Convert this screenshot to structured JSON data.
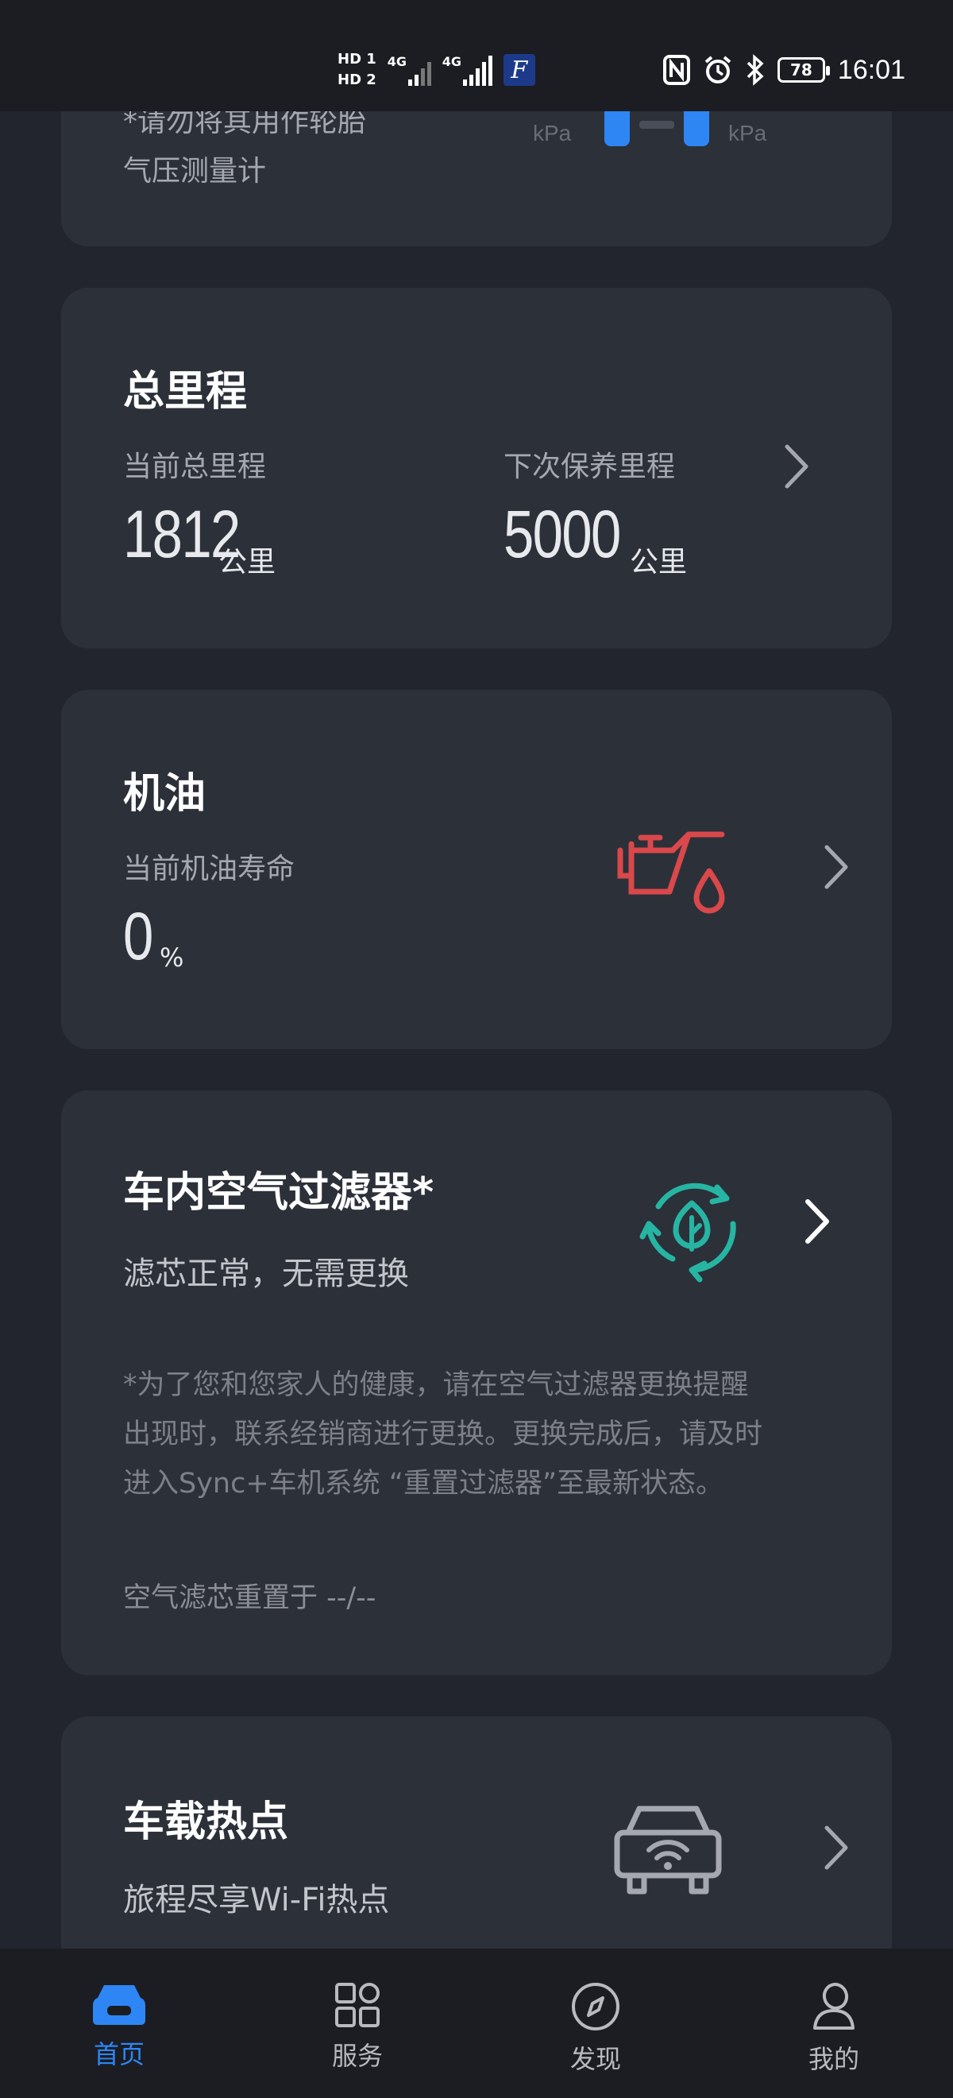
{
  "status_bar": {
    "hd1": "HD 1",
    "hd2": "HD 2",
    "net1": "4G",
    "net2": "4G",
    "app_badge": "F",
    "battery": "78",
    "time": "16:01"
  },
  "tire_card": {
    "note_line1": "*请勿将其用作轮胎",
    "note_line2": "气压测量计",
    "unit_left": "kPa",
    "unit_right": "kPa"
  },
  "mileage_card": {
    "title": "总里程",
    "current_label": "当前总里程",
    "current_value": "1812",
    "current_unit": "公里",
    "next_label": "下次保养里程",
    "next_value": "5000",
    "next_unit": "公里"
  },
  "oil_card": {
    "title": "机油",
    "life_label": "当前机油寿命",
    "life_value": "0",
    "life_unit": "%",
    "icon_color": "#d9484a"
  },
  "filter_card": {
    "title": "车内空气过滤器*",
    "status": "滤芯正常，无需更换",
    "note_line1": "*为了您和您家人的健康，请在空气过滤器更换提醒",
    "note_line2": "出现时，联系经销商进行更换。更换完成后，请及时",
    "note_line3": "进入Sync+车机系统 “重置过滤器”至最新状态。",
    "reset_text": "空气滤芯重置于 --/--",
    "icon_color": "#26b5a3"
  },
  "hotspot_card": {
    "title": "车载热点",
    "subtitle": "旅程尽享Wi-Fi热点"
  },
  "bottom_nav": {
    "items": [
      {
        "label": "首页",
        "icon": "car-icon"
      },
      {
        "label": "服务",
        "icon": "grid-icon"
      },
      {
        "label": "发现",
        "icon": "compass-icon"
      },
      {
        "label": "我的",
        "icon": "person-icon"
      }
    ],
    "active_color": "#2e86f5"
  }
}
